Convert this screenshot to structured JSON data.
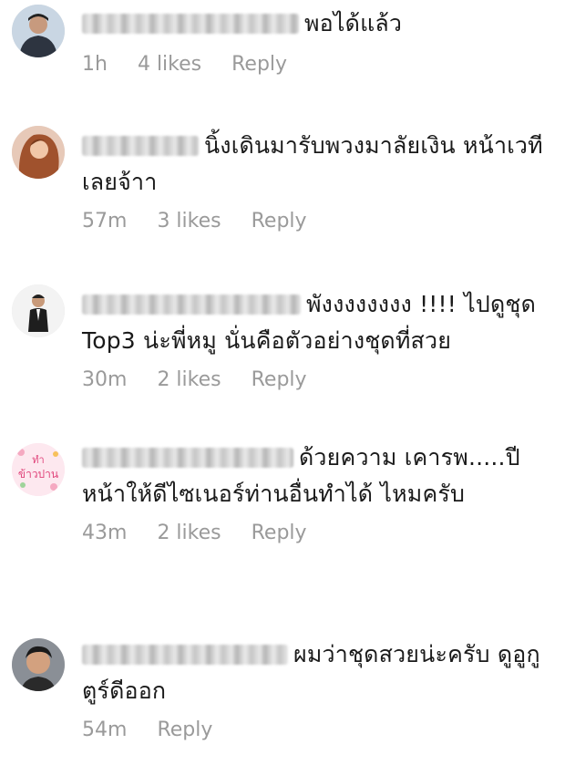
{
  "comments": [
    {
      "avatar": "person-in-dark-jacket",
      "text": "พอได้แล้ว",
      "time": "1h",
      "likes": "4 likes",
      "reply": "Reply"
    },
    {
      "avatar": "person-with-long-hair",
      "text": "นิ้งเดินมารับพวงมาลัยเงิน หน้าเวทีเลยจ้าา",
      "time": "57m",
      "likes": "3 likes",
      "reply": "Reply"
    },
    {
      "avatar": "person-in-suit",
      "text": "พังงงงงงงง !!!! ไปดูชุด Top3 น่ะพี่หมู นั่นคือตัวอย่างชุดที่สวย",
      "time": "30m",
      "likes": "2 likes",
      "reply": "Reply"
    },
    {
      "avatar": "pink-sticker",
      "avatar_text": [
        "ทำ",
        "ข้าวปาน"
      ],
      "text": "ด้วยความ เคารพ.....ปีหน้าให้ดีไซเนอร์ท่านอื่นทำได้ ไหมครับ",
      "time": "43m",
      "likes": "2 likes",
      "reply": "Reply"
    },
    {
      "avatar": "young-man-portrait",
      "text": "ผมว่าชุดสวยน่ะครับ ดูอูกูตูร์ดีออก",
      "time": "54m",
      "likes": "",
      "reply": "Reply"
    }
  ]
}
